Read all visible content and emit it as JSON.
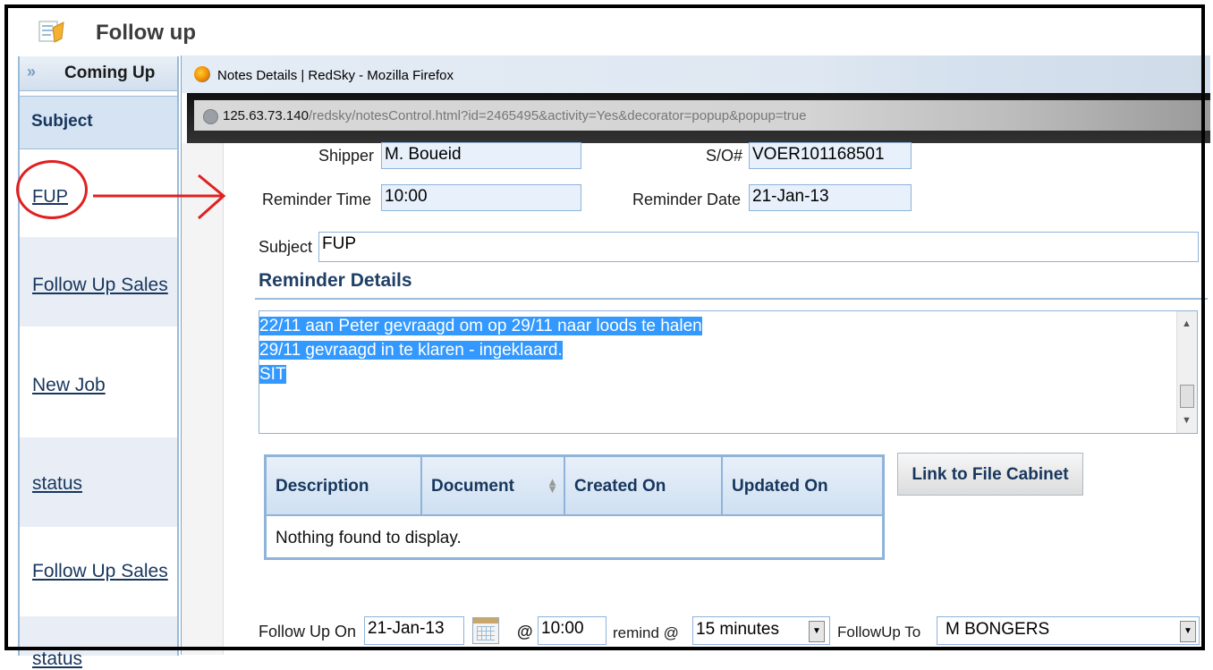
{
  "app": {
    "title": "Follow up"
  },
  "left_panel": {
    "tab_label": "Coming Up",
    "column_header": "Subject",
    "items": [
      "FUP",
      "Follow Up Sales",
      "New Job",
      "status",
      "Follow Up Sales",
      "status"
    ]
  },
  "popup": {
    "window_title": "Notes Details | RedSky - Mozilla Firefox",
    "url_host": "125.63.73.140",
    "url_path": "/redsky/notesControl.html?id=2465495&activity=Yes&decorator=popup&popup=true"
  },
  "form": {
    "shipper_label": "Shipper",
    "shipper_value": "M. Boueid",
    "so_label": "S/O#",
    "so_value": "VOER101168501",
    "reminder_time_label": "Reminder Time",
    "reminder_time_value": "10:00",
    "reminder_date_label": "Reminder Date",
    "reminder_date_value": "21-Jan-13",
    "subject_label": "Subject",
    "subject_value": "FUP"
  },
  "reminder_details": {
    "title": "Reminder Details",
    "lines": [
      "22/11 aan Peter gevraagd om op 29/11 naar loods te halen",
      "29/11 gevraagd in te klaren - ingeklaard.",
      "SIT"
    ]
  },
  "documents_table": {
    "headers": [
      "Description",
      "Document",
      "Created On",
      "Updated On"
    ],
    "empty_message": "Nothing found to display."
  },
  "link_button": "Link to File Cabinet",
  "followup": {
    "on_label": "Follow Up On",
    "on_value": "21-Jan-13",
    "at_label": "@",
    "at_value": "10:00",
    "remind_label": "remind @",
    "remind_value": "15 minutes",
    "to_label": "FollowUp To",
    "to_value": "M BONGERS"
  },
  "icons": [
    "app-icon",
    "chevron-double-right-icon",
    "firefox-icon",
    "globe-icon",
    "sort-icon",
    "calendar-icon",
    "dropdown-arrow-icon"
  ],
  "colors": {
    "annotation": "#e02020",
    "link": "#17365d",
    "highlight": "#3399ff",
    "field_bg": "#e8f1fb"
  }
}
